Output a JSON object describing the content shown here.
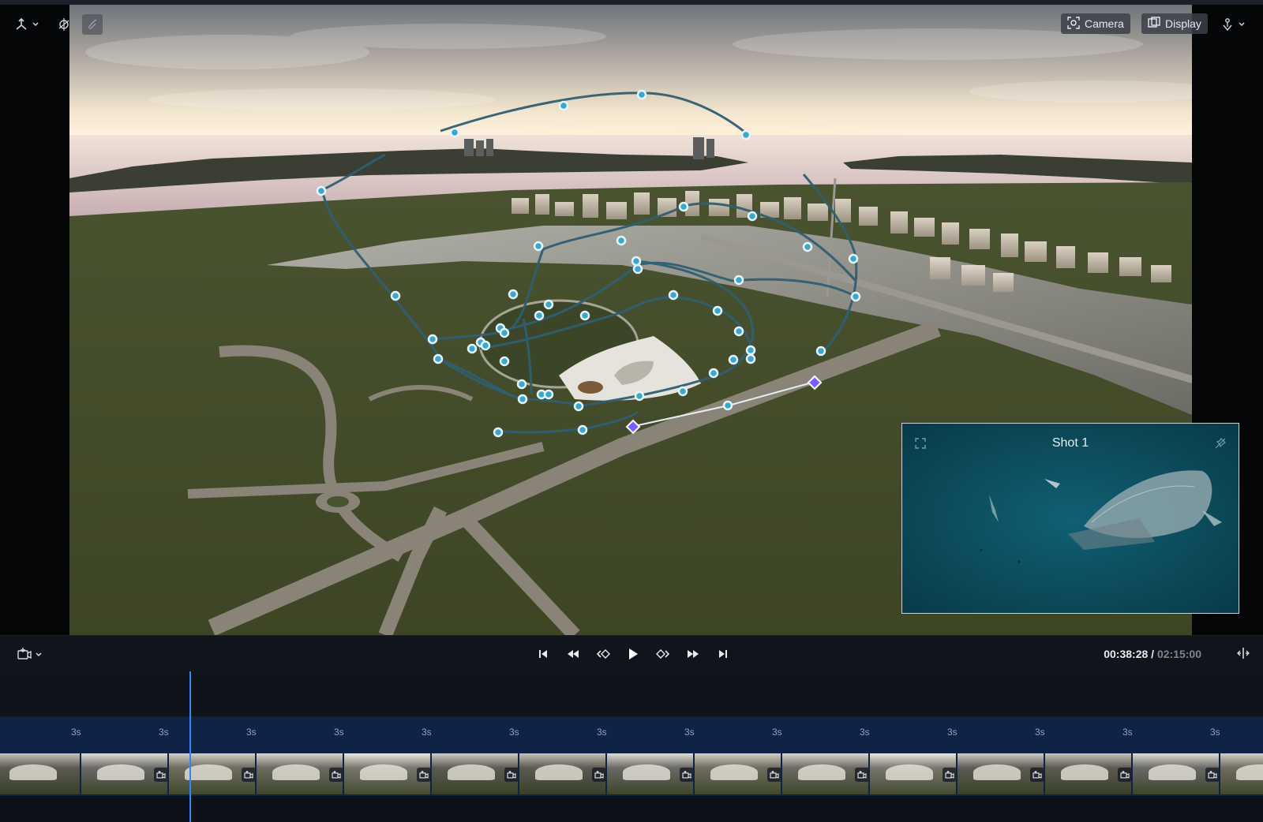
{
  "viewport": {
    "toolbar_left": [
      {
        "name": "transform-tool-icon",
        "has_dropdown": true
      },
      {
        "name": "pivot-tool-icon"
      },
      {
        "name": "paint-tool-icon"
      }
    ],
    "camera_label": "Camera",
    "display_label": "Display",
    "right_tool": {
      "name": "person-anchor-icon",
      "has_dropdown": true
    }
  },
  "preview": {
    "title": "Shot 1",
    "expand_icon": "expand-icon",
    "pin_icon": "unpin-icon"
  },
  "transport": {
    "add_shot_icon": "add-camera-shot-icon",
    "controls": [
      {
        "name": "skip-to-start-button",
        "icon": "skip-start-icon"
      },
      {
        "name": "rewind-button",
        "icon": "rewind-icon"
      },
      {
        "name": "prev-keyframe-button",
        "icon": "prev-keyframe-icon"
      },
      {
        "name": "play-button",
        "icon": "play-icon"
      },
      {
        "name": "next-keyframe-button",
        "icon": "next-keyframe-icon"
      },
      {
        "name": "fast-forward-button",
        "icon": "fast-forward-icon"
      },
      {
        "name": "skip-to-end-button",
        "icon": "skip-end-icon"
      }
    ],
    "current_time": "00:38:28",
    "separator": " / ",
    "total_time": "02:15:00",
    "split_icon": "split-view-icon"
  },
  "timeline": {
    "shot_durations": [
      "3s",
      "3s",
      "3s",
      "3s",
      "3s",
      "3s",
      "3s",
      "3s",
      "3s",
      "3s",
      "3s",
      "3s",
      "3s",
      "3s"
    ],
    "playhead_position_fraction": 0.285
  },
  "colors": {
    "accent": "#2f86ff",
    "path": "#2f5f72",
    "keyframe": "#3aa9c9",
    "selected_keyframe": "#7a5cff",
    "timeline_track": "#0f2346"
  }
}
